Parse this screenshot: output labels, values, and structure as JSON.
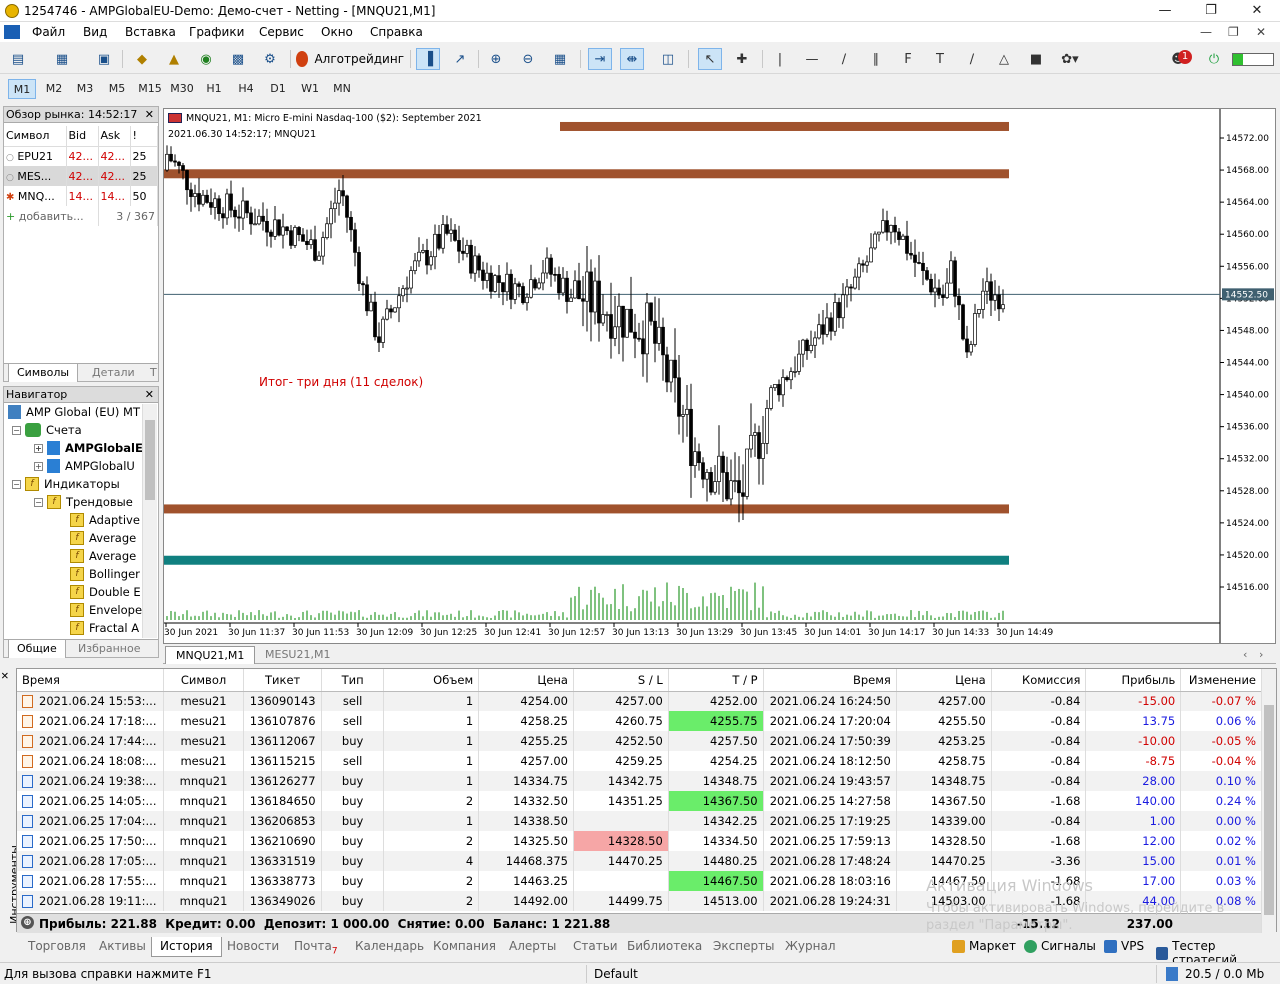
{
  "window": {
    "title": "1254746 - AMPGlobalEU-Demo: Демо-счет - Netting - [MNQU21,M1]"
  },
  "menu": [
    "Файл",
    "Вид",
    "Вставка",
    "Графики",
    "Сервис",
    "Окно",
    "Справка"
  ],
  "toolbar": {
    "algo_label": "Алготрейдинг"
  },
  "notifications": {
    "badge": "1"
  },
  "timeframes": [
    "M1",
    "M2",
    "M3",
    "M5",
    "M15",
    "M30",
    "H1",
    "H4",
    "D1",
    "W1",
    "MN"
  ],
  "market_watch": {
    "title": "Обзор рынка: 14:52:17",
    "columns": [
      "Символ",
      "Bid",
      "Ask",
      "!"
    ],
    "rows": [
      {
        "symbol": "EPU21",
        "bid": "42...",
        "ask": "42...",
        "spread": "25"
      },
      {
        "symbol": "MES...",
        "bid": "42...",
        "ask": "42...",
        "spread": "25"
      },
      {
        "symbol": "MNQ...",
        "bid": "14...",
        "ask": "14...",
        "spread": "50"
      }
    ],
    "add_label": "добавить...",
    "count": "3 / 367",
    "tabs": [
      "Символы",
      "Детали",
      "Т"
    ]
  },
  "navigator": {
    "title": "Навигатор",
    "items": [
      "AMP Global (EU) MT",
      "Счета",
      "AMPGlobalE",
      "AMPGlobalU",
      "Индикаторы",
      "Трендовые",
      "Adaptive",
      "Average",
      "Average",
      "Bollinger",
      "Double E",
      "Envelope",
      "Fractal A"
    ],
    "tabs": [
      "Общие",
      "Избранное"
    ]
  },
  "chart": {
    "header": "MNQU21, M1:  Micro E-mini Nasdaq-100 ($2): September 2021",
    "subheader": "2021.06.30 14:52:17; MNQU21",
    "annotation": "Итог- три дня (11 сделок)",
    "current_price": "14552.50",
    "price_ticks": [
      "14572.00",
      "14568.00",
      "14564.00",
      "14560.00",
      "14556.00",
      "14552.00",
      "14548.00",
      "14544.00",
      "14540.00",
      "14536.00",
      "14532.00",
      "14528.00",
      "14524.00",
      "14520.00",
      "14516.00"
    ],
    "time_ticks": [
      "30 Jun 2021",
      "30 Jun 11:37",
      "30 Jun 11:53",
      "30 Jun 12:09",
      "30 Jun 12:25",
      "30 Jun 12:41",
      "30 Jun 12:57",
      "30 Jun 13:13",
      "30 Jun 13:29",
      "30 Jun 13:45",
      "30 Jun 14:01",
      "30 Jun 14:17",
      "30 Jun 14:33",
      "30 Jun 14:49"
    ],
    "levels": [
      {
        "price": 14573.5,
        "color": "#a0522d"
      },
      {
        "price": 14567.6,
        "color": "#a0522d"
      },
      {
        "price": 14525.8,
        "color": "#a0522d"
      },
      {
        "price": 14519.4,
        "color": "#108080"
      }
    ],
    "tabs": [
      "MNQU21,M1",
      "MESU21,M1"
    ]
  },
  "history": {
    "columns": [
      "Время",
      "Символ",
      "Тикет",
      "Тип",
      "Объем",
      "Цена",
      "S / L",
      "T / P",
      "Время",
      "Цена",
      "Комиссия",
      "Прибыль",
      "Изменение"
    ],
    "rows": [
      {
        "open": "2021.06.24 15:53:...",
        "symbol": "mesu21",
        "ticket": "136090143",
        "type": "sell",
        "volume": "1",
        "price": "4254.00",
        "sl": "4257.00",
        "tp": "4252.00",
        "close": "2021.06.24 16:24:50",
        "close_price": "4257.00",
        "commission": "-0.84",
        "profit": "-15.00",
        "change": "-0.07 %",
        "hl": "sl"
      },
      {
        "open": "2021.06.24 17:18:...",
        "symbol": "mesu21",
        "ticket": "136107876",
        "type": "sell",
        "volume": "1",
        "price": "4258.25",
        "sl": "4260.75",
        "tp": "4255.75",
        "close": "2021.06.24 17:20:04",
        "close_price": "4255.50",
        "commission": "-0.84",
        "profit": "13.75",
        "change": "0.06 %",
        "hl": "tp"
      },
      {
        "open": "2021.06.24 17:44:...",
        "symbol": "mesu21",
        "ticket": "136112067",
        "type": "buy",
        "volume": "1",
        "price": "4255.25",
        "sl": "4252.50",
        "tp": "4257.50",
        "close": "2021.06.24 17:50:39",
        "close_price": "4253.25",
        "commission": "-0.84",
        "profit": "-10.00",
        "change": "-0.05 %",
        "hl": ""
      },
      {
        "open": "2021.06.24 18:08:...",
        "symbol": "mesu21",
        "ticket": "136115215",
        "type": "sell",
        "volume": "1",
        "price": "4257.00",
        "sl": "4259.25",
        "tp": "4254.25",
        "close": "2021.06.24 18:12:50",
        "close_price": "4258.75",
        "commission": "-0.84",
        "profit": "-8.75",
        "change": "-0.04 %",
        "hl": ""
      },
      {
        "open": "2021.06.24 19:38:...",
        "symbol": "mnqu21",
        "ticket": "136126277",
        "type": "buy",
        "volume": "1",
        "price": "14334.75",
        "sl": "14342.75",
        "tp": "14348.75",
        "close": "2021.06.24 19:43:57",
        "close_price": "14348.75",
        "commission": "-0.84",
        "profit": "28.00",
        "change": "0.10 %",
        "hl": "tp"
      },
      {
        "open": "2021.06.25 14:05:...",
        "symbol": "mnqu21",
        "ticket": "136184650",
        "type": "buy",
        "volume": "2",
        "price": "14332.50",
        "sl": "14351.25",
        "tp": "14367.50",
        "close": "2021.06.25 14:27:58",
        "close_price": "14367.50",
        "commission": "-1.68",
        "profit": "140.00",
        "change": "0.24 %",
        "hl": "tp"
      },
      {
        "open": "2021.06.25 17:04:...",
        "symbol": "mnqu21",
        "ticket": "136206853",
        "type": "buy",
        "volume": "1",
        "price": "14338.50",
        "sl": "",
        "tp": "14342.25",
        "close": "2021.06.25 17:19:25",
        "close_price": "14339.00",
        "commission": "-0.84",
        "profit": "1.00",
        "change": "0.00 %",
        "hl": ""
      },
      {
        "open": "2021.06.25 17:50:...",
        "symbol": "mnqu21",
        "ticket": "136210690",
        "type": "buy",
        "volume": "2",
        "price": "14325.50",
        "sl": "14328.50",
        "tp": "14334.50",
        "close": "2021.06.25 17:59:13",
        "close_price": "14328.50",
        "commission": "-1.68",
        "profit": "12.00",
        "change": "0.02 %",
        "hl": "sl"
      },
      {
        "open": "2021.06.28 17:05:...",
        "symbol": "mnqu21",
        "ticket": "136331519",
        "type": "buy",
        "volume": "4",
        "price": "14468.375",
        "sl": "14470.25",
        "tp": "14480.25",
        "close": "2021.06.28 17:48:24",
        "close_price": "14470.25",
        "commission": "-3.36",
        "profit": "15.00",
        "change": "0.01 %",
        "hl": "sl"
      },
      {
        "open": "2021.06.28 17:55:...",
        "symbol": "mnqu21",
        "ticket": "136338773",
        "type": "buy",
        "volume": "2",
        "price": "14463.25",
        "sl": "",
        "tp": "14467.50",
        "close": "2021.06.28 18:03:16",
        "close_price": "14467.50",
        "commission": "-1.68",
        "profit": "17.00",
        "change": "0.03 %",
        "hl": "tp"
      },
      {
        "open": "2021.06.28 19:11:...",
        "symbol": "mnqu21",
        "ticket": "136349026",
        "type": "buy",
        "volume": "2",
        "price": "14492.00",
        "sl": "14499.75",
        "tp": "14513.00",
        "close": "2021.06.28 19:24:31",
        "close_price": "14503.00",
        "commission": "-1.68",
        "profit": "44.00",
        "change": "0.08 %",
        "hl": ""
      }
    ],
    "totals": {
      "summary": "Прибыль: 221.88  Кредит: 0.00  Депозит: 1 000.00  Снятие: 0.00  Баланс: 1 221.88",
      "commission": "-15.12",
      "profit": "237.00"
    }
  },
  "side_tab": "Инструменты",
  "bottom_tabs": [
    "Торговля",
    "Активы",
    "История",
    "Новости",
    "Почта",
    "Календарь",
    "Компания",
    "Алерты",
    "Статьи",
    "Библиотека",
    "Эксперты",
    "Журнал"
  ],
  "mail_count": "7",
  "right_tabs": [
    "Маркет",
    "Сигналы",
    "VPS",
    "Тестер стратегий"
  ],
  "watermark": {
    "line1": "Активация Windows",
    "line2": "Чтобы активировать Windows, перейдите в",
    "line3": "раздел \"Параметры\"."
  },
  "status": {
    "help": "Для вызова справки нажмите F1",
    "profile": "Default",
    "traffic": "20.5 / 0.0 Mb"
  }
}
